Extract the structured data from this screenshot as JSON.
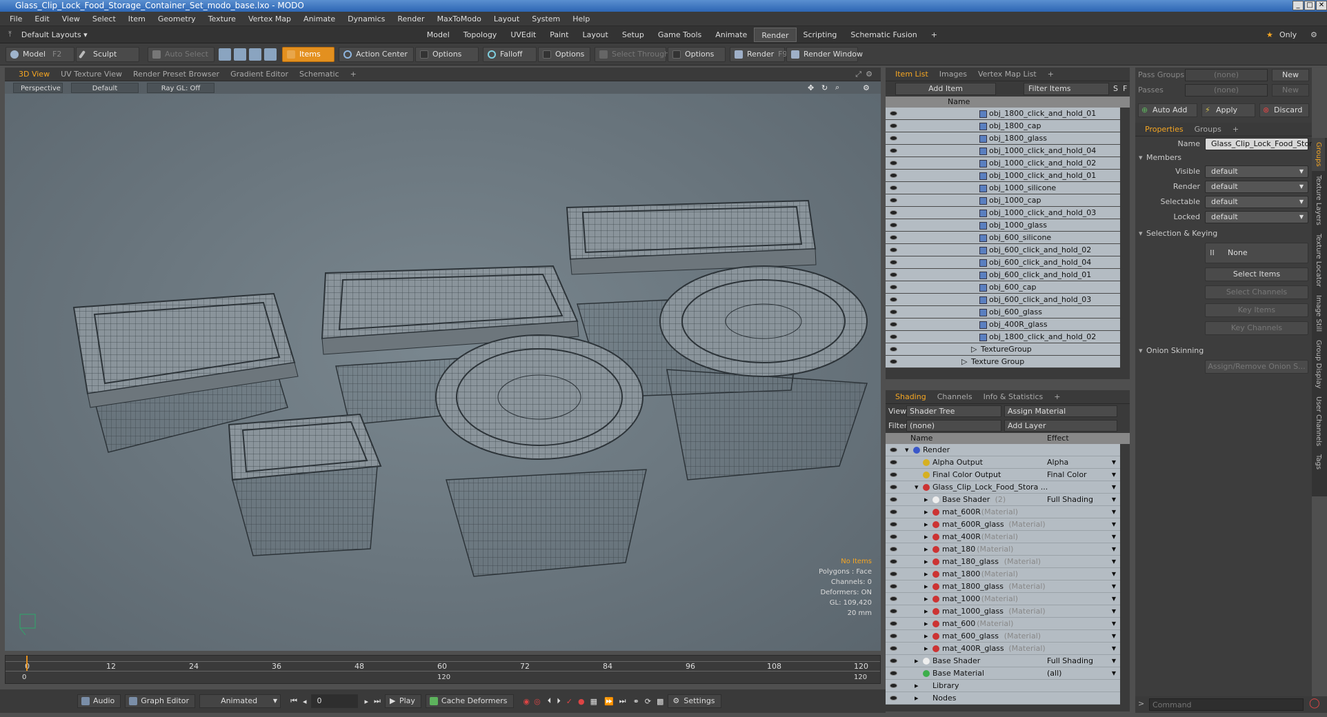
{
  "window": {
    "title": "Glass_Clip_Lock_Food_Storage_Container_Set_modo_base.lxo - MODO"
  },
  "menu": [
    "File",
    "Edit",
    "View",
    "Select",
    "Item",
    "Geometry",
    "Texture",
    "Vertex Map",
    "Animate",
    "Dynamics",
    "Render",
    "MaxToModo",
    "Layout",
    "System",
    "Help"
  ],
  "layouts": {
    "default": "Default Layouts ▾",
    "tabs": [
      "Model",
      "Topology",
      "UVEdit",
      "Paint",
      "Layout",
      "Setup",
      "Game Tools",
      "Animate",
      "Render",
      "Scripting",
      "Schematic Fusion"
    ],
    "active": "Render",
    "only": "Only"
  },
  "toolbar": {
    "model": "Model",
    "model_key": "F2",
    "sculpt": "Sculpt",
    "auto_select": "Auto Select",
    "items": "Items",
    "action_center": "Action Center",
    "options1": "Options",
    "falloff": "Falloff",
    "options2": "Options",
    "select_through": "Select Through",
    "options3": "Options",
    "render": "Render",
    "render_key": "F9",
    "render_window": "Render Window"
  },
  "viewport": {
    "tabs": [
      "3D View",
      "UV Texture View",
      "Render Preset Browser",
      "Gradient Editor",
      "Schematic"
    ],
    "active_tab": "3D View",
    "projection": "Perspective",
    "style": "Default",
    "raygl": "Ray GL: Off",
    "info": {
      "items": "No Items",
      "polygons": "Polygons : Face",
      "channels": "Channels: 0",
      "deformers": "Deformers: ON",
      "gl": "GL: 109,420",
      "units": "20 mm"
    }
  },
  "timeline": {
    "ticks": [
      "0",
      "12",
      "24",
      "36",
      "48",
      "60",
      "72",
      "84",
      "96",
      "108",
      "120"
    ],
    "start": "0",
    "end": "120"
  },
  "bottom": {
    "audio": "Audio",
    "graph_editor": "Graph Editor",
    "animated": "Animated",
    "frame": "0",
    "play": "Play",
    "cache": "Cache Deformers",
    "settings": "Settings"
  },
  "itemlist": {
    "tabs": [
      "Item List",
      "Images",
      "Vertex Map List"
    ],
    "add_item": "Add Item",
    "filter": "Filter Items",
    "col_name": "Name",
    "items": [
      "obj_1800_click_and_hold_01",
      "obj_1800_cap",
      "obj_1800_glass",
      "obj_1000_click_and_hold_04",
      "obj_1000_click_and_hold_02",
      "obj_1000_click_and_hold_01",
      "obj_1000_silicone",
      "obj_1000_cap",
      "obj_1000_click_and_hold_03",
      "obj_1000_glass",
      "obj_600_silicone",
      "obj_600_click_and_hold_02",
      "obj_600_click_and_hold_04",
      "obj_600_click_and_hold_01",
      "obj_600_cap",
      "obj_600_click_and_hold_03",
      "obj_600_glass",
      "obj_400R_glass",
      "obj_1800_click_and_hold_02"
    ],
    "groups": [
      "TextureGroup",
      "Texture Group"
    ]
  },
  "shading": {
    "tabs": [
      "Shading",
      "Channels",
      "Info & Statistics"
    ],
    "view_label": "View",
    "view": "Shader Tree",
    "assign": "Assign Material",
    "filter_label": "Filter",
    "filter": "(none)",
    "add_layer": "Add Layer",
    "col_name": "Name",
    "col_effect": "Effect",
    "rows": [
      {
        "name": "Render",
        "suffix": "",
        "effect": "",
        "indent": 0,
        "kind": "render"
      },
      {
        "name": "Alpha Output",
        "suffix": "",
        "effect": "Alpha",
        "indent": 1,
        "kind": "output"
      },
      {
        "name": "Final Color Output",
        "suffix": "",
        "effect": "Final Color",
        "indent": 1,
        "kind": "output"
      },
      {
        "name": "Glass_Clip_Lock_Food_Stora ...",
        "suffix": "",
        "effect": "",
        "indent": 1,
        "kind": "group"
      },
      {
        "name": "Base Shader",
        "suffix": "(2)",
        "effect": "Full Shading",
        "indent": 2,
        "kind": "shader"
      },
      {
        "name": "mat_600R",
        "suffix": "(Material)",
        "effect": "",
        "indent": 2,
        "kind": "mat"
      },
      {
        "name": "mat_600R_glass",
        "suffix": "(Material)",
        "effect": "",
        "indent": 2,
        "kind": "mat"
      },
      {
        "name": "mat_400R",
        "suffix": "(Material)",
        "effect": "",
        "indent": 2,
        "kind": "mat"
      },
      {
        "name": "mat_180",
        "suffix": "(Material)",
        "effect": "",
        "indent": 2,
        "kind": "mat"
      },
      {
        "name": "mat_180_glass",
        "suffix": "(Material)",
        "effect": "",
        "indent": 2,
        "kind": "mat"
      },
      {
        "name": "mat_1800",
        "suffix": "(Material)",
        "effect": "",
        "indent": 2,
        "kind": "mat"
      },
      {
        "name": "mat_1800_glass",
        "suffix": "(Material)",
        "effect": "",
        "indent": 2,
        "kind": "mat"
      },
      {
        "name": "mat_1000",
        "suffix": "(Material)",
        "effect": "",
        "indent": 2,
        "kind": "mat"
      },
      {
        "name": "mat_1000_glass",
        "suffix": "(Material)",
        "effect": "",
        "indent": 2,
        "kind": "mat"
      },
      {
        "name": "mat_600",
        "suffix": "(Material)",
        "effect": "",
        "indent": 2,
        "kind": "mat"
      },
      {
        "name": "mat_600_glass",
        "suffix": "(Material)",
        "effect": "",
        "indent": 2,
        "kind": "mat"
      },
      {
        "name": "mat_400R_glass",
        "suffix": "(Material)",
        "effect": "",
        "indent": 2,
        "kind": "mat"
      },
      {
        "name": "Base Shader",
        "suffix": "",
        "effect": "Full Shading",
        "indent": 1,
        "kind": "shader"
      },
      {
        "name": "Base Material",
        "suffix": "",
        "effect": "(all)",
        "indent": 1,
        "kind": "basemat"
      },
      {
        "name": "Library",
        "suffix": "",
        "effect": "",
        "indent": 1,
        "kind": "folder"
      },
      {
        "name": "Nodes",
        "suffix": "",
        "effect": "",
        "indent": 1,
        "kind": "folder"
      }
    ]
  },
  "props": {
    "pass_groups_label": "Pass Groups",
    "pass_groups": "(none)",
    "passes_label": "Passes",
    "passes": "(none)",
    "new": "New",
    "auto_add": "Auto Add",
    "apply": "Apply",
    "discard": "Discard",
    "tabs": [
      "Properties",
      "Groups"
    ],
    "name_label": "Name",
    "name": "Glass_Clip_Lock_Food_Storag",
    "members": "Members",
    "visible_label": "Visible",
    "render_label": "Render",
    "selectable_label": "Selectable",
    "locked_label": "Locked",
    "default": "default",
    "sel_keying": "Selection & Keying",
    "none": "None",
    "select_items": "Select Items",
    "select_channels": "Select Channels",
    "key_items": "Key Items",
    "key_channels": "Key Channels",
    "onion": "Onion Skinning",
    "assign_remove": "Assign/Remove Onion S..."
  },
  "sidetabs": [
    "Groups",
    "Texture Layers",
    "Texture Locator",
    "Image Still",
    "Group Display",
    "User Channels",
    "Tags"
  ],
  "command": {
    "placeholder": "Command"
  },
  "colors": {
    "accent": "#f5a623",
    "viewport": "#6a757d",
    "list": "#b4bcc3"
  }
}
